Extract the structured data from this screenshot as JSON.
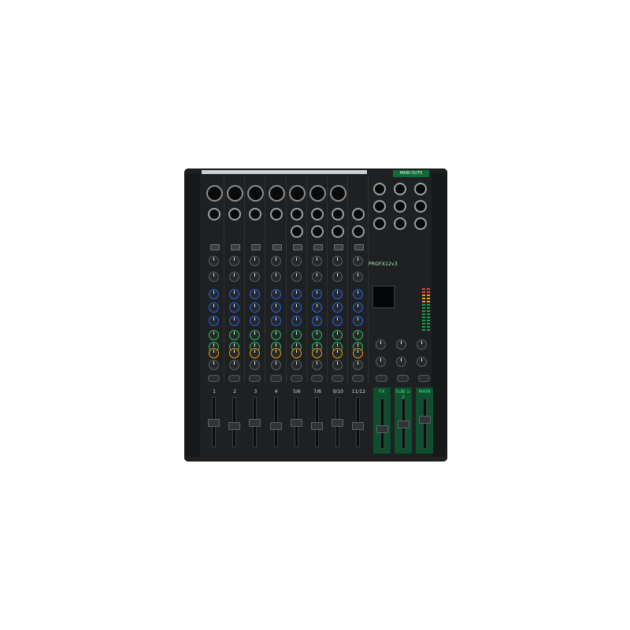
{
  "product": {
    "brand_logo": "PROFX12v3",
    "main_outs_label": "MAIN OUTS"
  },
  "channels": [
    {
      "number": "1"
    },
    {
      "number": "2"
    },
    {
      "number": "3"
    },
    {
      "number": "4"
    },
    {
      "number": "5/6"
    },
    {
      "number": "7/8"
    },
    {
      "number": "9/10"
    },
    {
      "number": "11/12"
    }
  ],
  "master": {
    "fx_label": "FX",
    "sub_label": "SUB 1-2",
    "main_label": "MAIN"
  },
  "colors": {
    "body": "#1e2021",
    "accent_green": "#16a34a",
    "eq_blue": "#2563eb",
    "aux_green": "#22c55e",
    "fx_orange": "#f59e0b"
  }
}
